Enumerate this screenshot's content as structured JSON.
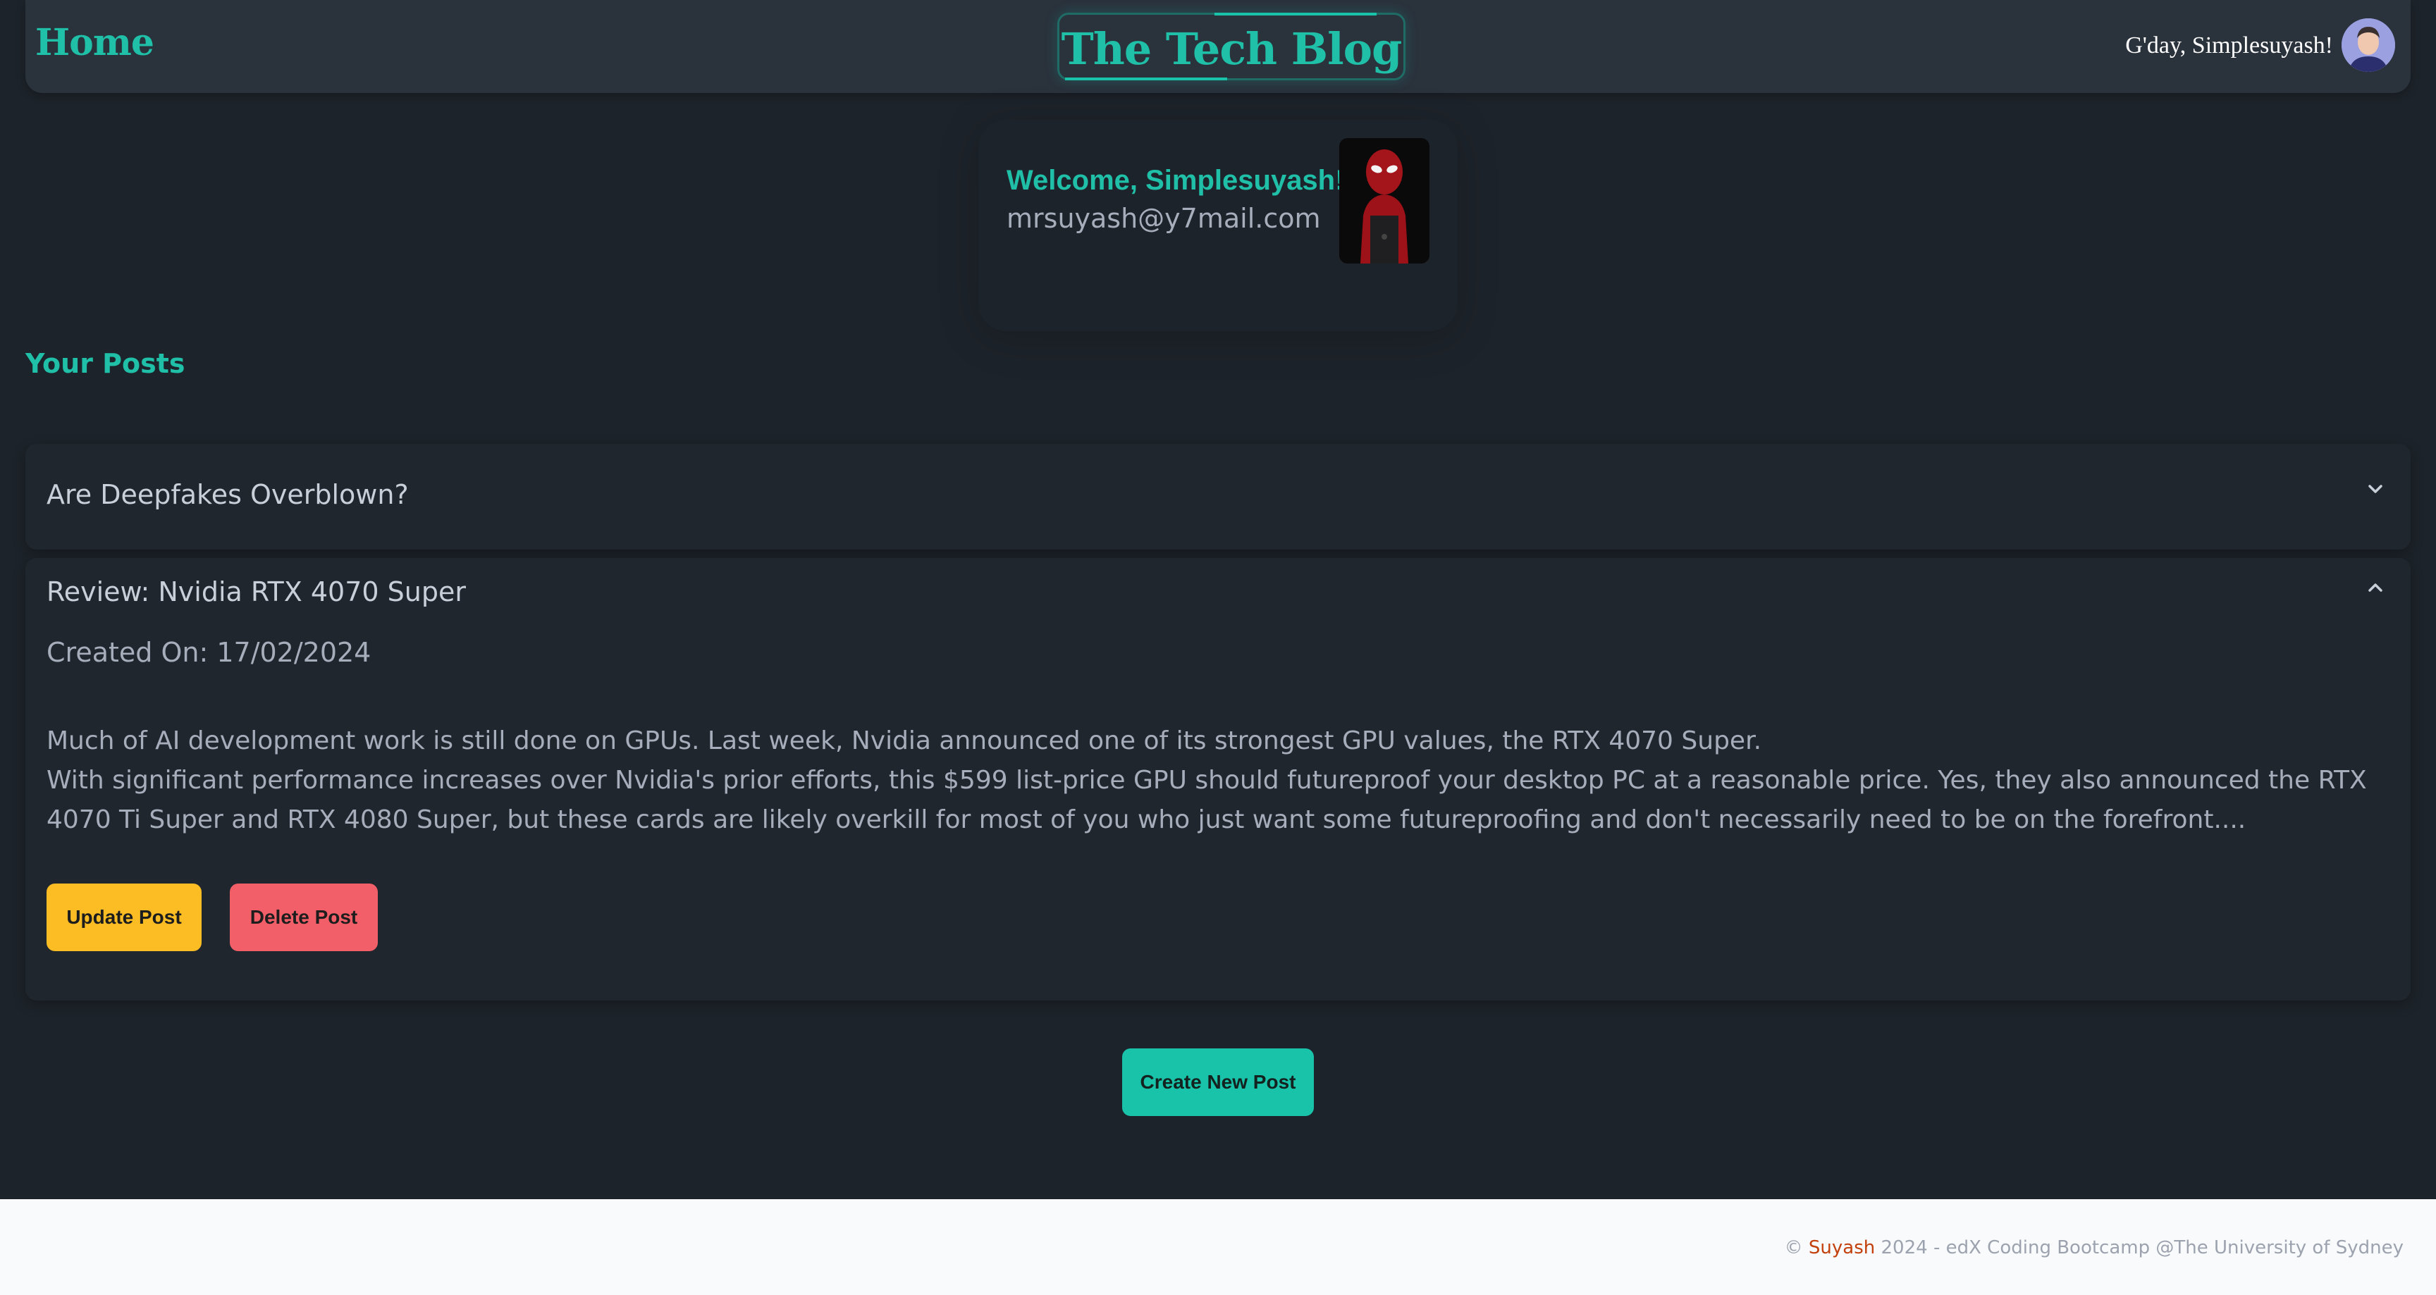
{
  "navbar": {
    "home_label": "Home",
    "brand": "The Tech Blog",
    "greeting": "G'day, Simplesuyash!",
    "avatar_icon": "user-avatar"
  },
  "profile": {
    "welcome": "Welcome, Simplesuyash!",
    "email": "mrsuyash@y7mail.com",
    "picture_icon": "spiderman-portrait"
  },
  "posts_section": {
    "title": "Your Posts",
    "posts": [
      {
        "title": "Are Deepfakes Overblown?",
        "expanded": false,
        "toggle_icon": "chevron-down-icon"
      },
      {
        "title": "Review: Nvidia RTX 4070 Super",
        "expanded": true,
        "toggle_icon": "chevron-up-icon",
        "created": "Created On: 17/02/2024",
        "body_line1": "Much of AI development work is still done on GPUs. Last week, Nvidia announced one of its strongest GPU values, the RTX 4070 Super.",
        "body_line2": "With significant performance increases over Nvidia's prior efforts, this $599 list-price GPU should futureproof your desktop PC at a reasonable price. Yes, they also announced the RTX 4070 Ti Super and RTX 4080 Super, but these cards are likely overkill for most of you who just want some futureproofing and don't necessarily need to be on the forefront....",
        "update_label": "Update Post",
        "delete_label": "Delete Post"
      }
    ]
  },
  "create_label": "Create New Post",
  "footer": {
    "copyright_symbol": "©",
    "author": "Suyash",
    "rest": "2024 - edX Coding Bootcamp @The University of Sydney"
  },
  "colors": {
    "accent": "#1fbfa8",
    "update_button": "#fbbd23",
    "delete_button": "#f25f68",
    "create_button": "#19c3aa",
    "background": "#1d232a"
  }
}
